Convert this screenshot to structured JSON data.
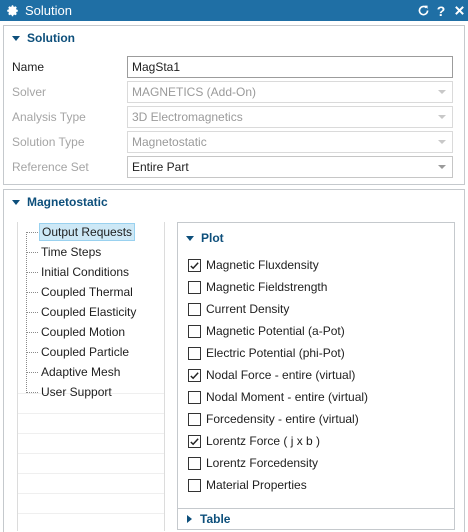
{
  "window": {
    "title": "Solution",
    "icons": [
      "gear-icon",
      "reset-icon",
      "help-icon",
      "close-icon"
    ]
  },
  "solution_section": {
    "header": "Solution",
    "fields": [
      {
        "label": "Name",
        "value": "MagSta1",
        "enabled": true,
        "type": "input"
      },
      {
        "label": "Solver",
        "value": "MAGNETICS (Add-On)",
        "enabled": false,
        "type": "select"
      },
      {
        "label": "Analysis Type",
        "value": "3D Electromagnetics",
        "enabled": false,
        "type": "select"
      },
      {
        "label": "Solution Type",
        "value": "Magnetostatic",
        "enabled": false,
        "type": "select"
      },
      {
        "label": "Reference Set",
        "value": "Entire Part",
        "enabled": true,
        "type": "select"
      }
    ]
  },
  "magnetostatic_section": {
    "header": "Magnetostatic",
    "tree": [
      "Output Requests",
      "Time Steps",
      "Initial Conditions",
      "Coupled Thermal",
      "Coupled Elasticity",
      "Coupled Motion",
      "Coupled Particle",
      "Adaptive Mesh",
      "User Support"
    ],
    "selected": "Output Requests",
    "plot": {
      "header": "Plot",
      "items": [
        {
          "label": "Magnetic Fluxdensity",
          "checked": true
        },
        {
          "label": "Magnetic Fieldstrength",
          "checked": false
        },
        {
          "label": "Current Density",
          "checked": false
        },
        {
          "label": "Magnetic Potential (a-Pot)",
          "checked": false
        },
        {
          "label": "Electric Potential (phi-Pot)",
          "checked": false
        },
        {
          "label": "Nodal Force - entire (virtual)",
          "checked": true
        },
        {
          "label": "Nodal Moment - entire (virtual)",
          "checked": false
        },
        {
          "label": "Forcedensity - entire (virtual)",
          "checked": false
        },
        {
          "label": "Lorentz Force ( j x b )",
          "checked": true
        },
        {
          "label": "Lorentz Forcedensity",
          "checked": false
        },
        {
          "label": "Material Properties",
          "checked": false
        }
      ]
    },
    "table": {
      "header": "Table"
    }
  }
}
